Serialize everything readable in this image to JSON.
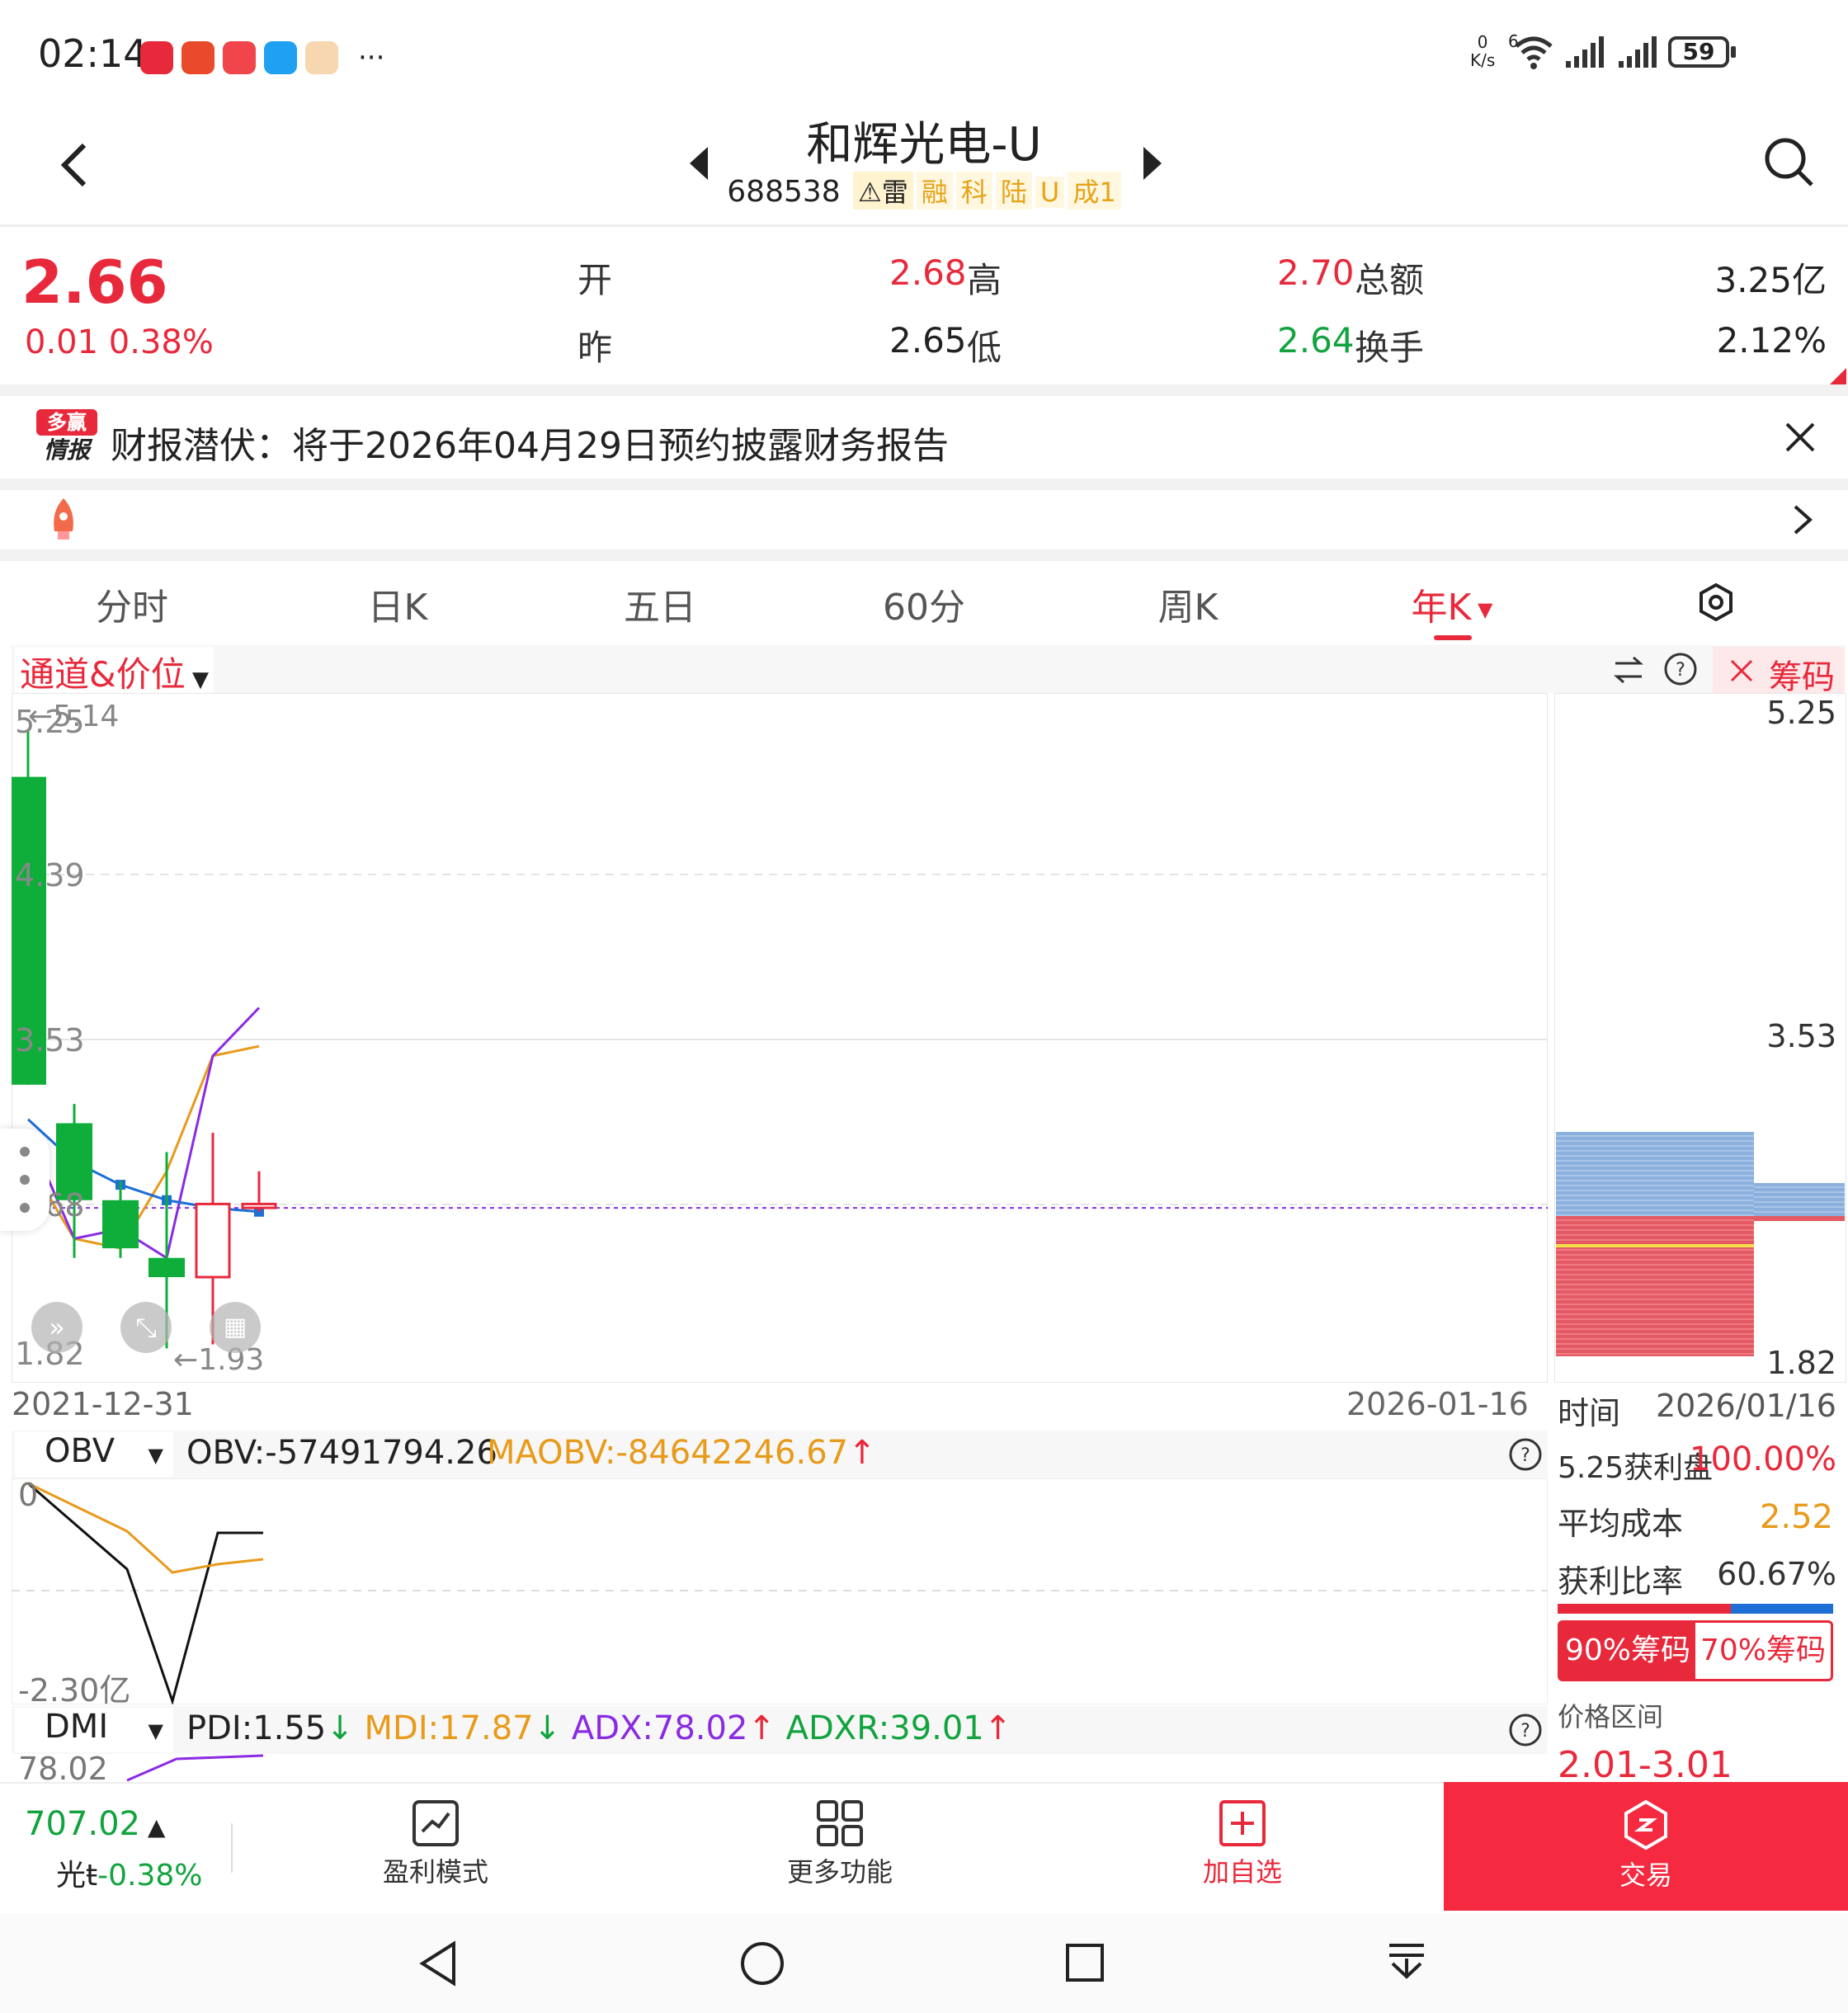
{
  "status_bar": {
    "time": "02:14",
    "net_speed_value": "0",
    "net_speed_unit": "K/s",
    "wifi_gen": "6",
    "battery": "59",
    "more_dots": "···"
  },
  "header": {
    "title": "和辉光电-U",
    "code": "688538",
    "tags": [
      "雷",
      "融",
      "科",
      "陆",
      "U",
      "成1"
    ]
  },
  "quote": {
    "price": "2.66",
    "change": "0.01 0.38%",
    "open_label": "开",
    "open": "2.68",
    "high_label": "高",
    "high": "2.70",
    "amount_label": "总额",
    "amount": "3.25亿",
    "prev_label": "昨",
    "prev": "2.65",
    "low_label": "低",
    "low": "2.64",
    "turnover_label": "换手",
    "turnover": "2.12%"
  },
  "news": {
    "logo_top": "多赢",
    "logo_bottom": "情报",
    "text": "财报潜伏：将于2026年04月29日预约披露财务报告"
  },
  "tabs": [
    "分时",
    "日K",
    "五日",
    "60分",
    "周K",
    "年K"
  ],
  "chart_header": {
    "indicator": "通道&价位",
    "chip_label": "筹码"
  },
  "chart_data": {
    "type": "candlestick",
    "price_axis": [
      "5.25",
      "4.39",
      "3.53",
      "2.68",
      "1.82"
    ],
    "chip_axis": [
      "5.25",
      "3.53",
      "1.82"
    ],
    "high_marker": "5.14",
    "low_marker": "1.93",
    "x_start": "2021-12-31",
    "x_end": "2026-01-16",
    "ylim": [
      1.82,
      5.25
    ],
    "candles": [
      {
        "o": 4.9,
        "c": 3.3,
        "h": 5.14,
        "l": 3.3,
        "color": "green"
      },
      {
        "o": 3.1,
        "c": 2.7,
        "h": 3.2,
        "l": 2.4,
        "color": "green"
      },
      {
        "o": 2.7,
        "c": 2.45,
        "h": 2.8,
        "l": 2.4,
        "color": "green"
      },
      {
        "o": 2.4,
        "c": 2.3,
        "h": 2.95,
        "l": 1.93,
        "color": "green"
      },
      {
        "o": 2.3,
        "c": 2.68,
        "h": 3.05,
        "l": 1.95,
        "color": "red"
      },
      {
        "o": 2.66,
        "c": 2.68,
        "h": 2.85,
        "l": 2.64,
        "color": "red"
      }
    ],
    "ma_blue": [
      3.12,
      2.9,
      2.78,
      2.7,
      2.66,
      2.64
    ],
    "ma_orange": [
      2.9,
      2.5,
      2.45,
      2.85,
      3.45,
      3.5
    ],
    "ma_purple": [
      3.05,
      2.5,
      2.55,
      2.4,
      3.45,
      3.7
    ],
    "current_price": 2.66
  },
  "obv": {
    "name": "OBV",
    "obv_value": "OBV:-57491794.26",
    "maobv_value": "MAOBV:-84642246.67",
    "top": "0",
    "bottom": "-2.30亿"
  },
  "dmi": {
    "name": "DMI",
    "pdi": "PDI:1.55",
    "mdi": "MDI:17.87",
    "adx": "ADX:78.02",
    "adxr": "ADXR:39.01",
    "top": "78.02"
  },
  "chip_panel": {
    "time_label": "时间",
    "time_value": "2026/01/16",
    "profit_label": "5.25获利盘",
    "profit_value": "100.00%",
    "avg_cost_label": "平均成本",
    "avg_cost_value": "2.52",
    "profit_ratio_label": "获利比率",
    "profit_ratio_value": "60.67%",
    "btn_90": "90%筹码",
    "btn_70": "70%筹码",
    "range_label": "价格区间",
    "range_value": "2.01-3.01"
  },
  "bottom_bar": {
    "index_value": "707.02",
    "index_name": "光ŧ",
    "index_change": "-0.38%",
    "profit_mode": "盈利模式",
    "more": "更多功能",
    "add_watch": "加自选",
    "trade": "交易"
  },
  "colors": {
    "accent_red": "#e8293b",
    "candle_green": "#0fae3a",
    "ma_blue": "#1d6fd6",
    "ma_orange": "#e89a1a",
    "ma_purple": "#8a2be2"
  }
}
